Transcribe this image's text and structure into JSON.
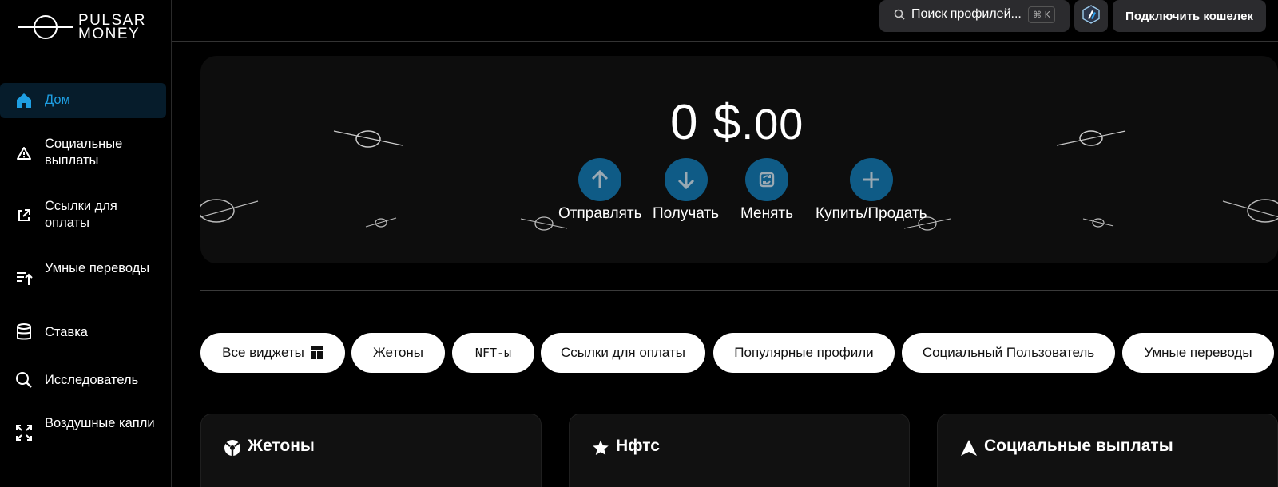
{
  "brand": {
    "line1": "PULSAR",
    "line2": "MONEY"
  },
  "sidebar": {
    "items": [
      {
        "label": "Дом",
        "icon": "home-icon",
        "active": true
      },
      {
        "label": "Социальные выплаты",
        "icon": "warning-triangle-icon"
      },
      {
        "label": "Ссылки для оплаты",
        "icon": "external-link-icon"
      },
      {
        "label": "Умные переводы",
        "icon": "transfer-list-icon"
      },
      {
        "label": "Ставка",
        "icon": "database-icon"
      },
      {
        "label": "Исследователь",
        "icon": "search-icon"
      },
      {
        "label": "Воздушные капли",
        "icon": "expand-arrows-icon"
      }
    ]
  },
  "header": {
    "search_placeholder": "Поиск профилей...",
    "search_shortcut": "⌘ K",
    "network_icon": "arbitrum-icon",
    "connect_wallet": "Подключить кошелек"
  },
  "hero": {
    "balance_main": "0 $",
    "balance_cents": ".00",
    "actions": [
      {
        "label": "Отправлять",
        "icon": "arrow-up-icon"
      },
      {
        "label": "Получать",
        "icon": "arrow-down-icon"
      },
      {
        "label": "Менять",
        "icon": "swap-icon"
      },
      {
        "label": "Купить/Продать",
        "icon": "plus-icon"
      }
    ],
    "accent_color": "#0f5b86"
  },
  "filters": [
    "Все виджеты",
    "Жетоны",
    "NFT-ы",
    "Ссылки для оплаты",
    "Популярные профили",
    "Социальный Пользователь",
    "Умные переводы"
  ],
  "cards": [
    {
      "title": "Жетоны",
      "icon": "token-icon"
    },
    {
      "title": "Нфтс",
      "icon": "star-icon"
    },
    {
      "title": "Социальные выплаты",
      "icon": "navigation-triangle-icon"
    }
  ]
}
